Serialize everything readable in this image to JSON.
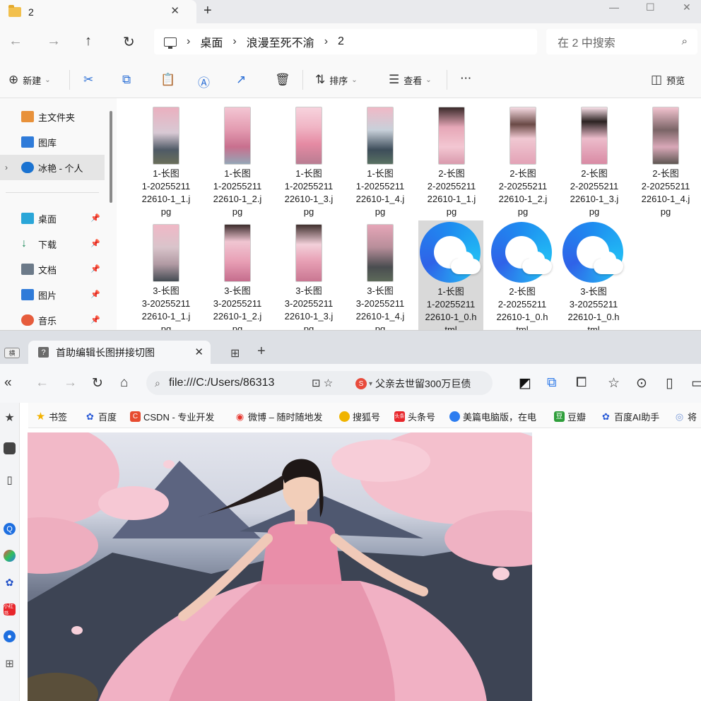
{
  "explorer": {
    "tab_title": "2",
    "breadcrumb": [
      "桌面",
      "浪漫至死不渝",
      "2"
    ],
    "search_placeholder": "在 2 中搜索",
    "commands": {
      "new": "新建",
      "sort": "排序",
      "view": "查看",
      "more": "···",
      "preview": "预览"
    },
    "nav": {
      "home": "主文件夹",
      "gallery": "图库",
      "cloud": "冰艳 - 个人",
      "desktop": "桌面",
      "downloads": "下载",
      "documents": "文档",
      "pictures": "图片",
      "music": "音乐"
    },
    "files": [
      {
        "name": [
          "1-长图",
          "1-20255211",
          "22610-1_1.j",
          "pg"
        ],
        "type": "image"
      },
      {
        "name": [
          "1-长图",
          "1-20255211",
          "22610-1_2.j",
          "pg"
        ],
        "type": "image"
      },
      {
        "name": [
          "1-长图",
          "1-20255211",
          "22610-1_3.j",
          "pg"
        ],
        "type": "image"
      },
      {
        "name": [
          "1-长图",
          "1-20255211",
          "22610-1_4.j",
          "pg"
        ],
        "type": "image"
      },
      {
        "name": [
          "2-长图",
          "2-20255211",
          "22610-1_1.j",
          "pg"
        ],
        "type": "image"
      },
      {
        "name": [
          "2-长图",
          "2-20255211",
          "22610-1_2.j",
          "pg"
        ],
        "type": "image"
      },
      {
        "name": [
          "2-长图",
          "2-20255211",
          "22610-1_3.j",
          "pg"
        ],
        "type": "image"
      },
      {
        "name": [
          "2-长图",
          "2-20255211",
          "22610-1_4.j",
          "pg"
        ],
        "type": "image"
      },
      {
        "name": [
          "3-长图",
          "3-20255211",
          "22610-1_1.j",
          "pg"
        ],
        "type": "image"
      },
      {
        "name": [
          "3-长图",
          "3-20255211",
          "22610-1_2.j",
          "pg"
        ],
        "type": "image"
      },
      {
        "name": [
          "3-长图",
          "3-20255211",
          "22610-1_3.j",
          "pg"
        ],
        "type": "image"
      },
      {
        "name": [
          "3-长图",
          "3-20255211",
          "22610-1_4.j",
          "pg"
        ],
        "type": "image"
      },
      {
        "name": [
          "1-长图",
          "1-20255211",
          "22610-1_0.h",
          "tml"
        ],
        "type": "html"
      },
      {
        "name": [
          "2-长图",
          "2-20255211",
          "22610-1_0.h",
          "tml"
        ],
        "type": "html"
      },
      {
        "name": [
          "3-长图",
          "3-20255211",
          "22610-1_0.h",
          "tml"
        ],
        "type": "html"
      }
    ]
  },
  "browser": {
    "side_top_label": "横",
    "tab_title": "首助编辑长图拼接切图",
    "url": "file:///C:/Users/86313",
    "news_ticker": "父亲去世留300万巨债",
    "bookmarks": [
      "书签",
      "百度",
      "CSDN - 专业开发",
      "微博 – 随时随地发",
      "搜狐号",
      "头条号",
      "美篇电脑版，在电",
      "豆瓣",
      "百度AI助手",
      "将"
    ],
    "bookmark_badges": {
      "csdn": "C",
      "toutiao": "头条",
      "douban": "豆"
    }
  },
  "icons": {
    "accent": "#2b6fd6",
    "folder": "#f2c04d",
    "qq_browser": "#1e8cf0"
  }
}
